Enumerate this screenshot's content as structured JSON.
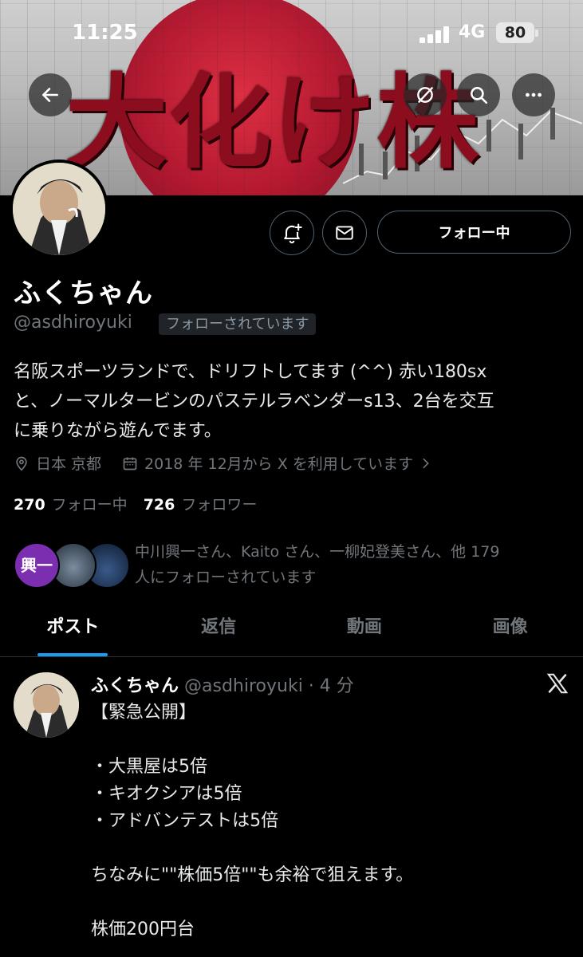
{
  "status": {
    "time": "11:25",
    "network": "4G",
    "battery": "80"
  },
  "banner": {
    "title": "大化け株"
  },
  "profile": {
    "name": "ふくちゃん",
    "handle": "@asdhiroyuki",
    "follows_you": "フォローされています",
    "follow_button": "フォロー中",
    "bio": [
      "名阪スポーツランドで、ドリフトしてます (^^) 赤い180sx",
      "と、ノーマルタービンのパステルラベンダーs13、2台を交互",
      "に乗りながら遊んでます。"
    ],
    "location": "日本 京都",
    "joined": "2018 年 12月から X を利用しています"
  },
  "counts": {
    "following_num": "270",
    "following_label": "フォロー中",
    "followers_num": "726",
    "followers_label": "フォロワー"
  },
  "mutuals": {
    "first_avatar_text": "興一",
    "line1": "中川興一さん、Kaito さん、一柳妃登美さん、他 179",
    "line2": "人にフォローされています"
  },
  "tabs": [
    "ポスト",
    "返信",
    "動画",
    "画像"
  ],
  "post": {
    "name": "ふくちゃん",
    "handle_time": "@asdhiroyuki · 4 分",
    "lines": [
      "【緊急公開】",
      "",
      "・大黒屋は5倍",
      "・キオクシアは5倍",
      "・アドバンテストは5倍",
      "",
      "ちなみに\"\"株価5倍\"\"も余裕で狙えます。",
      "",
      "株価200円台"
    ]
  },
  "colors": {
    "accent": "#1d9bf0",
    "background": "#000000",
    "muted": "#71767b",
    "mutual_avatar": "#7b2fb0"
  }
}
